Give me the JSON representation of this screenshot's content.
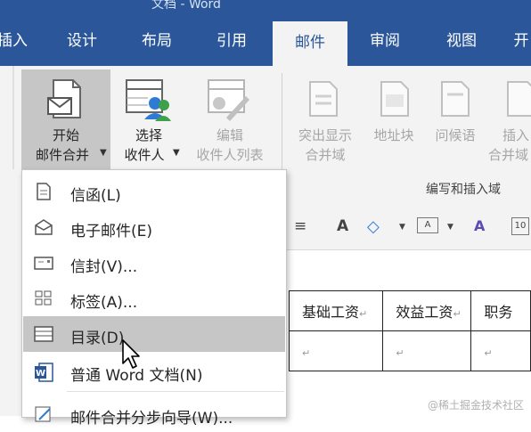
{
  "title_fragment": "文档 - Word",
  "tabs": [
    {
      "label": "插入",
      "active": false
    },
    {
      "label": "设计",
      "active": false
    },
    {
      "label": "布局",
      "active": false
    },
    {
      "label": "引用",
      "active": false
    },
    {
      "label": "邮件",
      "active": true
    },
    {
      "label": "审阅",
      "active": false
    },
    {
      "label": "视图",
      "active": false
    },
    {
      "label": "开",
      "active": false
    }
  ],
  "ribbon": {
    "start_merge": {
      "line1": "开始",
      "line2": "邮件合并"
    },
    "select_recipients": {
      "line1": "选择",
      "line2": "收件人"
    },
    "edit_recipients": {
      "line1": "编辑",
      "line2": "收件人列表"
    },
    "highlight_fields": {
      "line1": "突出显示",
      "line2": "合并域"
    },
    "address_block": {
      "label": "地址块"
    },
    "greeting_line": {
      "label": "问候语"
    },
    "insert_field": {
      "line1": "插入",
      "line2": "合并域"
    },
    "group_label": "编写和插入域"
  },
  "table": {
    "headers": [
      "基础工资",
      "效益工资",
      "职务"
    ],
    "cell_mark": "↵"
  },
  "menu": {
    "items": [
      {
        "label": "信函(L)",
        "icon": "letter-icon",
        "highlight": false
      },
      {
        "label": "电子邮件(E)",
        "icon": "email-icon",
        "highlight": false
      },
      {
        "label": "信封(V)...",
        "icon": "envelope-icon",
        "highlight": false
      },
      {
        "label": "标签(A)...",
        "icon": "labels-icon",
        "highlight": false
      },
      {
        "label": "目录(D)",
        "icon": "directory-icon",
        "highlight": true
      },
      {
        "label": "普通 Word 文档(N)",
        "icon": "word-doc-icon",
        "highlight": false
      },
      {
        "label": "邮件合并分步向导(W)...",
        "icon": "wizard-icon",
        "highlight": false
      }
    ]
  },
  "watermark": "@稀土掘金技术社区",
  "colors": {
    "accent": "#2b579a",
    "ribbon_bg": "#f3f3f3",
    "highlight": "#c6c6c6"
  }
}
